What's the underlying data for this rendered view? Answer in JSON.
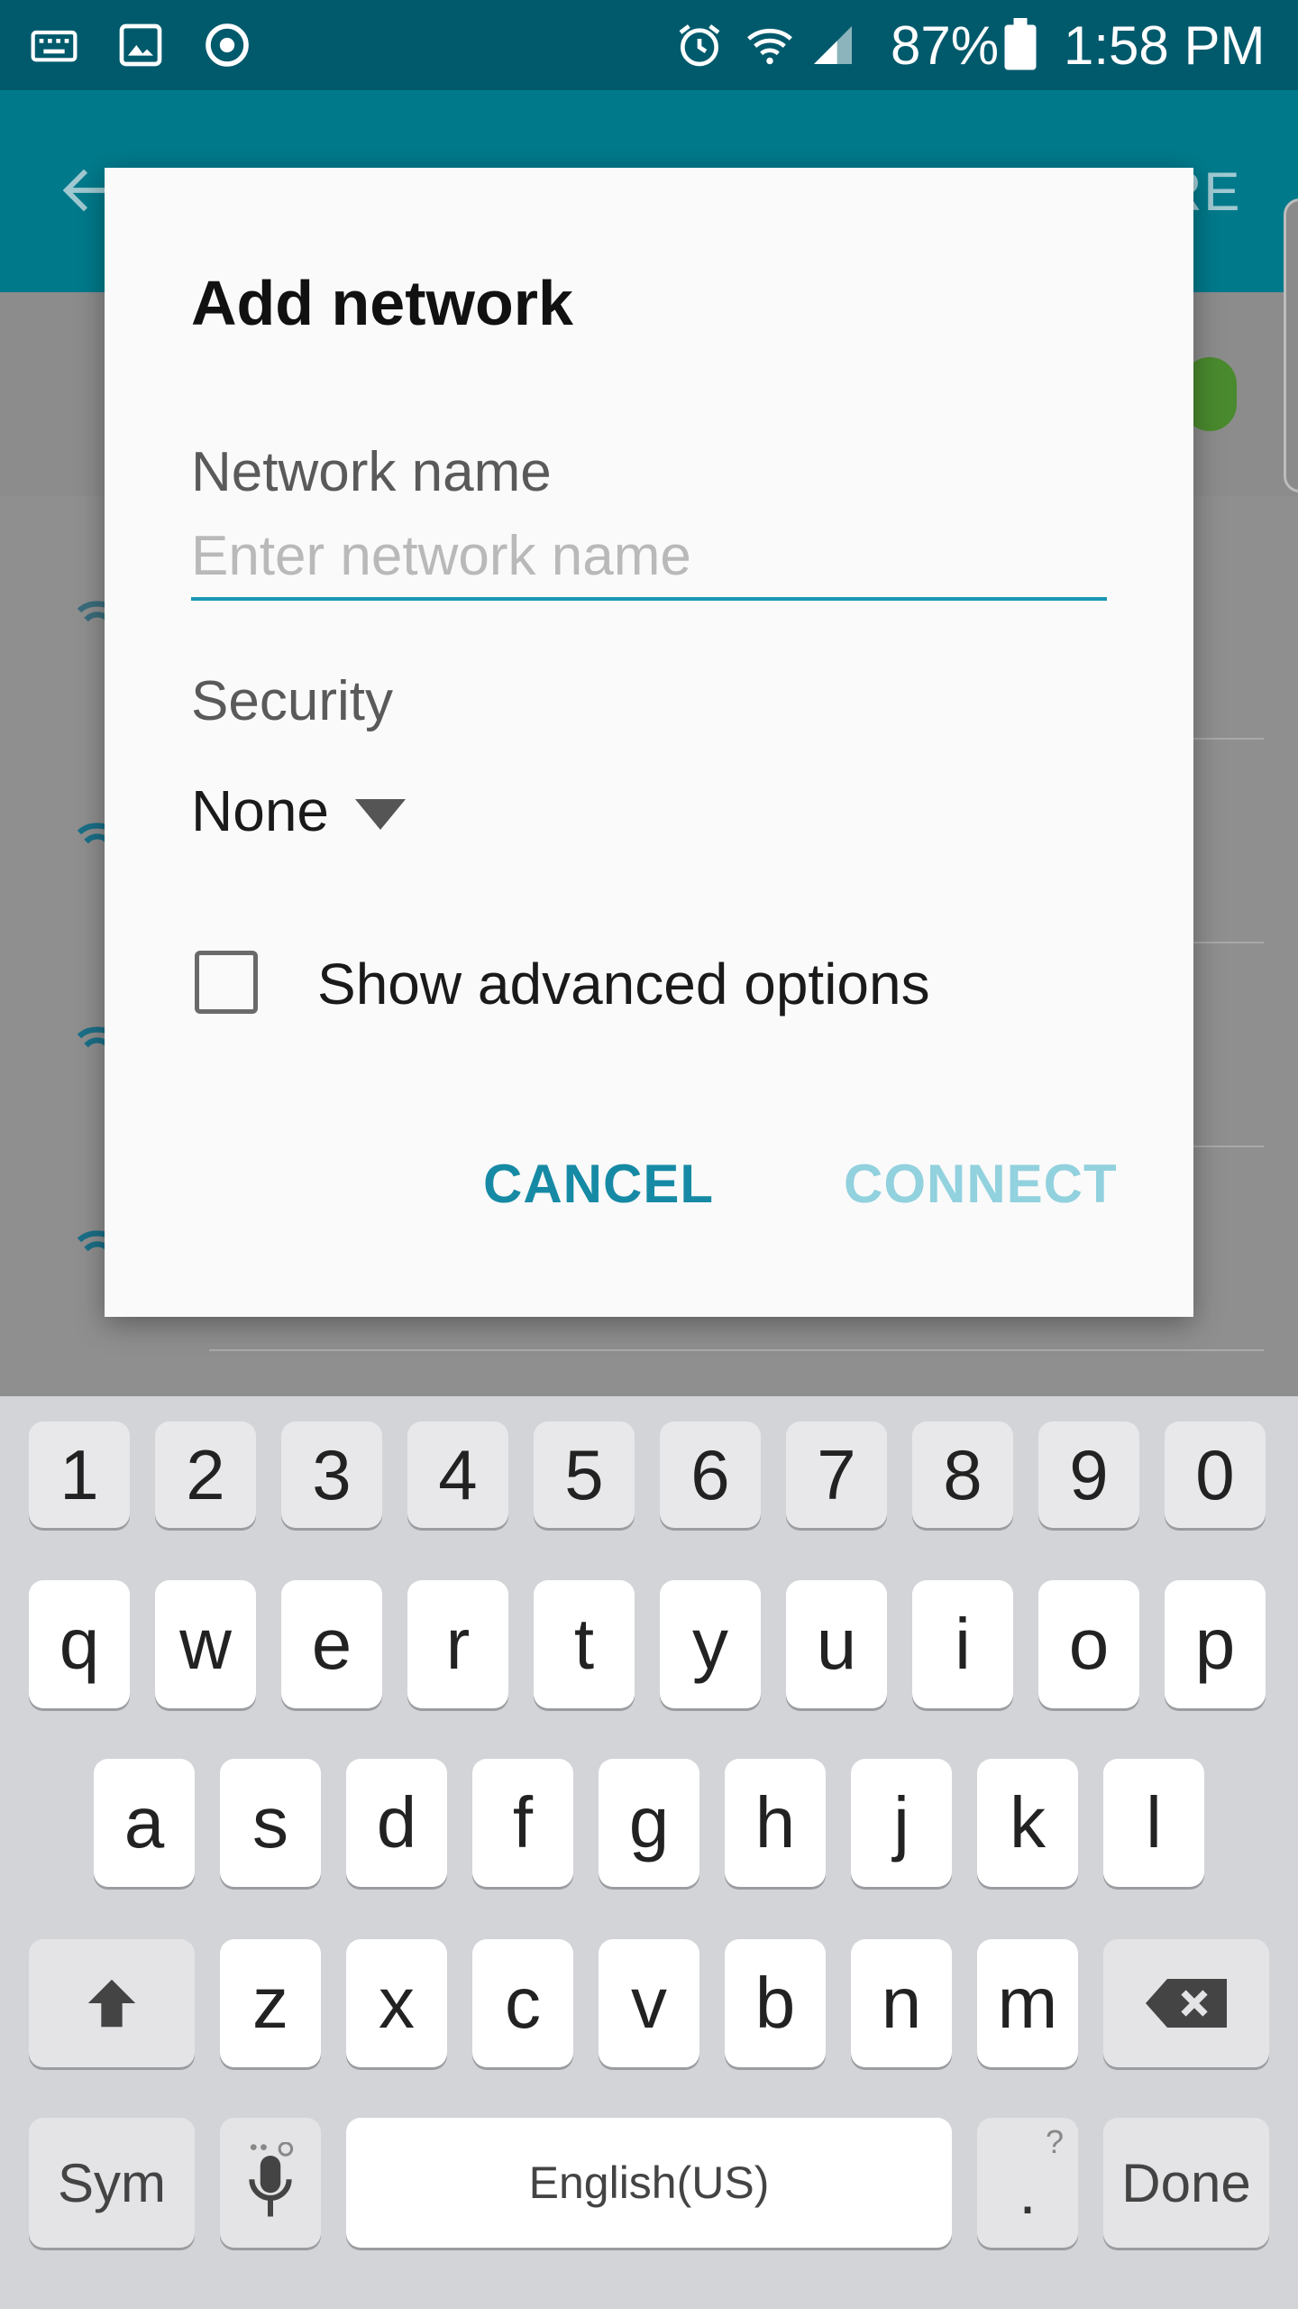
{
  "status_bar": {
    "battery": "87%",
    "time": "1:58 PM",
    "icons": [
      "keyboard-icon",
      "image-icon",
      "sync-icon",
      "alarm-icon",
      "wifi-icon",
      "signal-icon",
      "battery-icon"
    ]
  },
  "app_bar": {
    "action_partial": "RE"
  },
  "dialog": {
    "title": "Add network",
    "network_name_label": "Network name",
    "network_name_placeholder": "Enter network name",
    "network_name_value": "",
    "security_label": "Security",
    "security_value": "None",
    "advanced_label": "Show advanced options",
    "advanced_checked": false,
    "cancel_label": "CANCEL",
    "connect_label": "CONNECT"
  },
  "keyboard": {
    "numbers": [
      "1",
      "2",
      "3",
      "4",
      "5",
      "6",
      "7",
      "8",
      "9",
      "0"
    ],
    "row1": [
      "q",
      "w",
      "e",
      "r",
      "t",
      "y",
      "u",
      "i",
      "o",
      "p"
    ],
    "row2": [
      "a",
      "s",
      "d",
      "f",
      "g",
      "h",
      "j",
      "k",
      "l"
    ],
    "row3": [
      "z",
      "x",
      "c",
      "v",
      "b",
      "n",
      "m"
    ],
    "sym_label": "Sym",
    "space_label": "English(US)",
    "period_label": ".",
    "period_hint": "?",
    "done_label": "Done"
  },
  "colors": {
    "status_bar": "#005a6c",
    "app_bar": "#007a8b",
    "accent": "#1a97b3",
    "connect_disabled": "#92d1de"
  }
}
